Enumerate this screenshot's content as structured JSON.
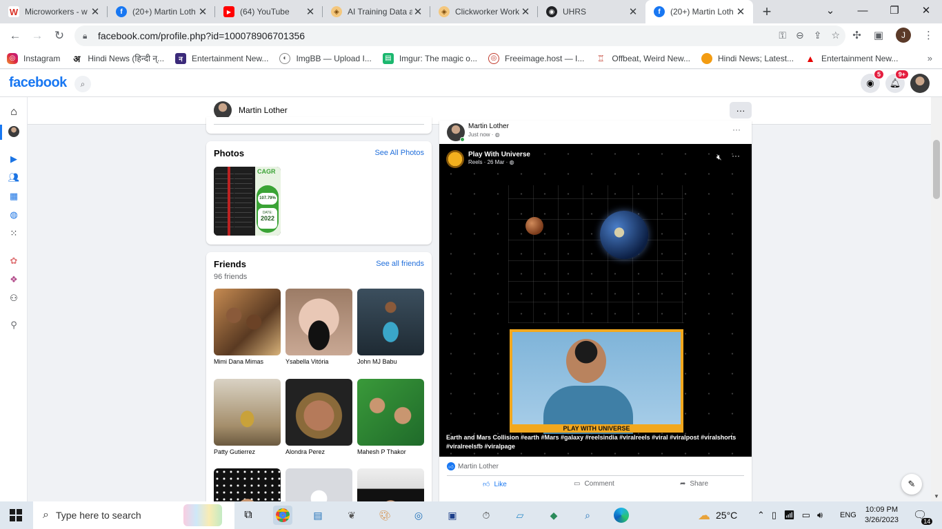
{
  "browser": {
    "tabs": [
      {
        "label": "Microworkers - w",
        "icon": "W",
        "icon_color": "#d93025",
        "active": false
      },
      {
        "label": "(20+) Martin Loth",
        "icon": "f",
        "icon_color": "#1877f2",
        "active": false
      },
      {
        "label": "(64) YouTube",
        "icon": "▶",
        "icon_color": "#ff0000",
        "active": false
      },
      {
        "label": "AI Training Data a",
        "icon": "◈",
        "icon_color": "#e8a33b",
        "active": false
      },
      {
        "label": "Clickworker Work",
        "icon": "◈",
        "icon_color": "#e8a33b",
        "active": false
      },
      {
        "label": "UHRS",
        "icon": "◉",
        "icon_color": "#202124",
        "active": false
      },
      {
        "label": "(20+) Martin Loth",
        "icon": "f",
        "icon_color": "#1877f2",
        "active": true
      }
    ],
    "url": "facebook.com/profile.php?id=100078906701356",
    "profile_initial": "J",
    "bookmarks": [
      {
        "label": "Instagram",
        "icon_color": "#d6249f"
      },
      {
        "label": "Hindi News (हिन्दी न्...",
        "icon_color": "#111111"
      },
      {
        "label": "Entertainment New...",
        "icon_color": "#3b2a7a"
      },
      {
        "label": "ImgBB — Upload I...",
        "icon_color": "#555555"
      },
      {
        "label": "Imgur: The magic o...",
        "icon_color": "#1bb76e"
      },
      {
        "label": "Freeimage.host — I...",
        "icon_color": "#c0392b"
      },
      {
        "label": "Offbeat, Weird New...",
        "icon_color": "#c0392b"
      },
      {
        "label": "Hindi News; Latest...",
        "icon_color": "#f39c12"
      },
      {
        "label": "Entertainment New...",
        "icon_color": "#e60000"
      }
    ]
  },
  "facebook": {
    "logo": "facebook",
    "badges": {
      "messenger": "5",
      "notifications": "9+"
    },
    "profile_name": "Martin Lother",
    "photos": {
      "title": "Photos",
      "link": "See All Photos",
      "image_text": {
        "brand": "CAGR",
        "percent": "107.79%",
        "date_label": "DATE:",
        "year": "2022"
      }
    },
    "friends": {
      "title": "Friends",
      "link": "See all friends",
      "count": "96 friends",
      "list": [
        {
          "name": "Mimi Dana Mimas"
        },
        {
          "name": "Ysabella Vitória"
        },
        {
          "name": "John MJ Babu"
        },
        {
          "name": "Patty Gutierrez"
        },
        {
          "name": "Alondra Perez"
        },
        {
          "name": "Mahesh P Thakor"
        }
      ]
    },
    "post": {
      "author": "Martin Lother",
      "time": "Just now · ",
      "shared_author": "Play With Universe",
      "shared_meta": "Reels · 26 Mar · ",
      "caption": "Earth and Mars Collision #earth #Mars #galaxy #reelsindia #viralreels #viral #viralpost #viralshorts #viralreelsfb #viralpage",
      "banner_text": "PLAY WITH UNIVERSE",
      "liked_by": "Martin Lother",
      "actions": {
        "like": "Like",
        "comment": "Comment",
        "share": "Share"
      }
    }
  },
  "taskbar": {
    "search_placeholder": "Type here to search",
    "weather": "25°C",
    "language": "ENG",
    "time": "10:09 PM",
    "date": "3/26/2023",
    "notifications": "14"
  }
}
